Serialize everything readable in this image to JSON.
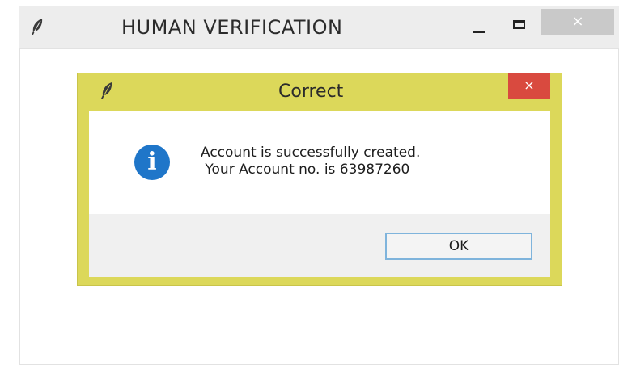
{
  "window": {
    "title": "HUMAN VERIFICATION",
    "icon": "feather-icon",
    "controls": {
      "minimize_icon": "minimize-icon",
      "maximize_icon": "maximize-icon",
      "close_label": "×"
    }
  },
  "dialog": {
    "title": "Correct",
    "icon": "feather-icon",
    "close_label": "×",
    "message_icon": "info-icon",
    "message_icon_glyph": "i",
    "message_line1": "Account is successfully created.",
    "message_line2": " Your Account no. is 63987260",
    "ok_label": "OK"
  },
  "colors": {
    "dialog_frame": "#dcd85a",
    "dialog_close": "#d94a3f",
    "info_icon": "#1f76c9",
    "ok_border": "#7fb4dc"
  }
}
